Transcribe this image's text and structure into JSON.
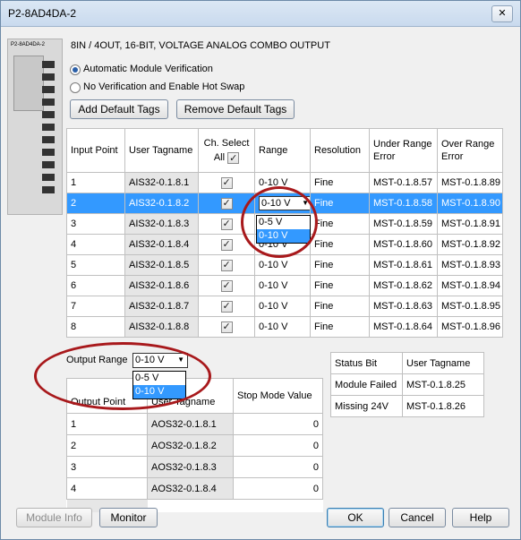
{
  "window": {
    "title": "P2-8AD4DA-2",
    "close_glyph": "✕"
  },
  "module": {
    "image_label": "P2-8AD4DA-2",
    "heading": "8IN / 4OUT, 16-BIT, VOLTAGE ANALOG COMBO OUTPUT"
  },
  "verification": {
    "options": [
      "Automatic Module Verification",
      "No Verification and Enable Hot Swap"
    ],
    "selected": 0
  },
  "tag_buttons": {
    "add": "Add Default Tags",
    "remove": "Remove Default Tags"
  },
  "input_table": {
    "headers": {
      "input_point": "Input Point",
      "user_tagname": "User Tagname",
      "ch_select": "Ch. Select",
      "all": "All",
      "range": "Range",
      "resolution": "Resolution",
      "under_range": "Under Range Error",
      "over_range": "Over Range Error"
    },
    "rows": [
      {
        "point": "1",
        "tag": "AIS32-0.1.8.1",
        "checked": true,
        "range": "0-10 V",
        "res": "Fine",
        "under": "MST-0.1.8.57",
        "over": "MST-0.1.8.89"
      },
      {
        "point": "2",
        "tag": "AIS32-0.1.8.2",
        "checked": true,
        "range": "0-10 V",
        "res": "Fine",
        "under": "MST-0.1.8.58",
        "over": "MST-0.1.8.90"
      },
      {
        "point": "3",
        "tag": "AIS32-0.1.8.3",
        "checked": true,
        "range": "0-10 V",
        "res": "Fine",
        "under": "MST-0.1.8.59",
        "over": "MST-0.1.8.91"
      },
      {
        "point": "4",
        "tag": "AIS32-0.1.8.4",
        "checked": true,
        "range": "0-10 V",
        "res": "Fine",
        "under": "MST-0.1.8.60",
        "over": "MST-0.1.8.92"
      },
      {
        "point": "5",
        "tag": "AIS32-0.1.8.5",
        "checked": true,
        "range": "0-10 V",
        "res": "Fine",
        "under": "MST-0.1.8.61",
        "over": "MST-0.1.8.93"
      },
      {
        "point": "6",
        "tag": "AIS32-0.1.8.6",
        "checked": true,
        "range": "0-10 V",
        "res": "Fine",
        "under": "MST-0.1.8.62",
        "over": "MST-0.1.8.94"
      },
      {
        "point": "7",
        "tag": "AIS32-0.1.8.7",
        "checked": true,
        "range": "0-10 V",
        "res": "Fine",
        "under": "MST-0.1.8.63",
        "over": "MST-0.1.8.95"
      },
      {
        "point": "8",
        "tag": "AIS32-0.1.8.8",
        "checked": true,
        "range": "0-10 V",
        "res": "Fine",
        "under": "MST-0.1.8.64",
        "over": "MST-0.1.8.96"
      }
    ],
    "selected_row": 1,
    "range_dropdown": {
      "value": "0-10 V",
      "options": [
        "0-5 V",
        "0-10 V"
      ],
      "highlighted": 1
    }
  },
  "output_range": {
    "label": "Output Range",
    "value": "0-10 V",
    "options": [
      "0-5 V",
      "0-10 V"
    ],
    "highlighted": 1
  },
  "output_table": {
    "headers": {
      "output_point": "Output Point",
      "user_tagname": "User Tagname",
      "stop_mode": "Stop Mode Value"
    },
    "rows": [
      {
        "point": "1",
        "tag": "AOS32-0.1.8.1",
        "value": "0"
      },
      {
        "point": "2",
        "tag": "AOS32-0.1.8.2",
        "value": "0"
      },
      {
        "point": "3",
        "tag": "AOS32-0.1.8.3",
        "value": "0"
      },
      {
        "point": "4",
        "tag": "AOS32-0.1.8.4",
        "value": "0"
      }
    ]
  },
  "status_table": {
    "headers": {
      "status_bit": "Status Bit",
      "user_tagname": "User Tagname"
    },
    "rows": [
      {
        "bit": "Module Failed",
        "tag": "MST-0.1.8.25"
      },
      {
        "bit": "Missing 24V",
        "tag": "MST-0.1.8.26"
      }
    ]
  },
  "footer": {
    "module_info": "Module Info",
    "monitor": "Monitor",
    "ok": "OK",
    "cancel": "Cancel",
    "help": "Help"
  },
  "colors": {
    "selection": "#3399ff",
    "annotation": "#a8191c"
  }
}
